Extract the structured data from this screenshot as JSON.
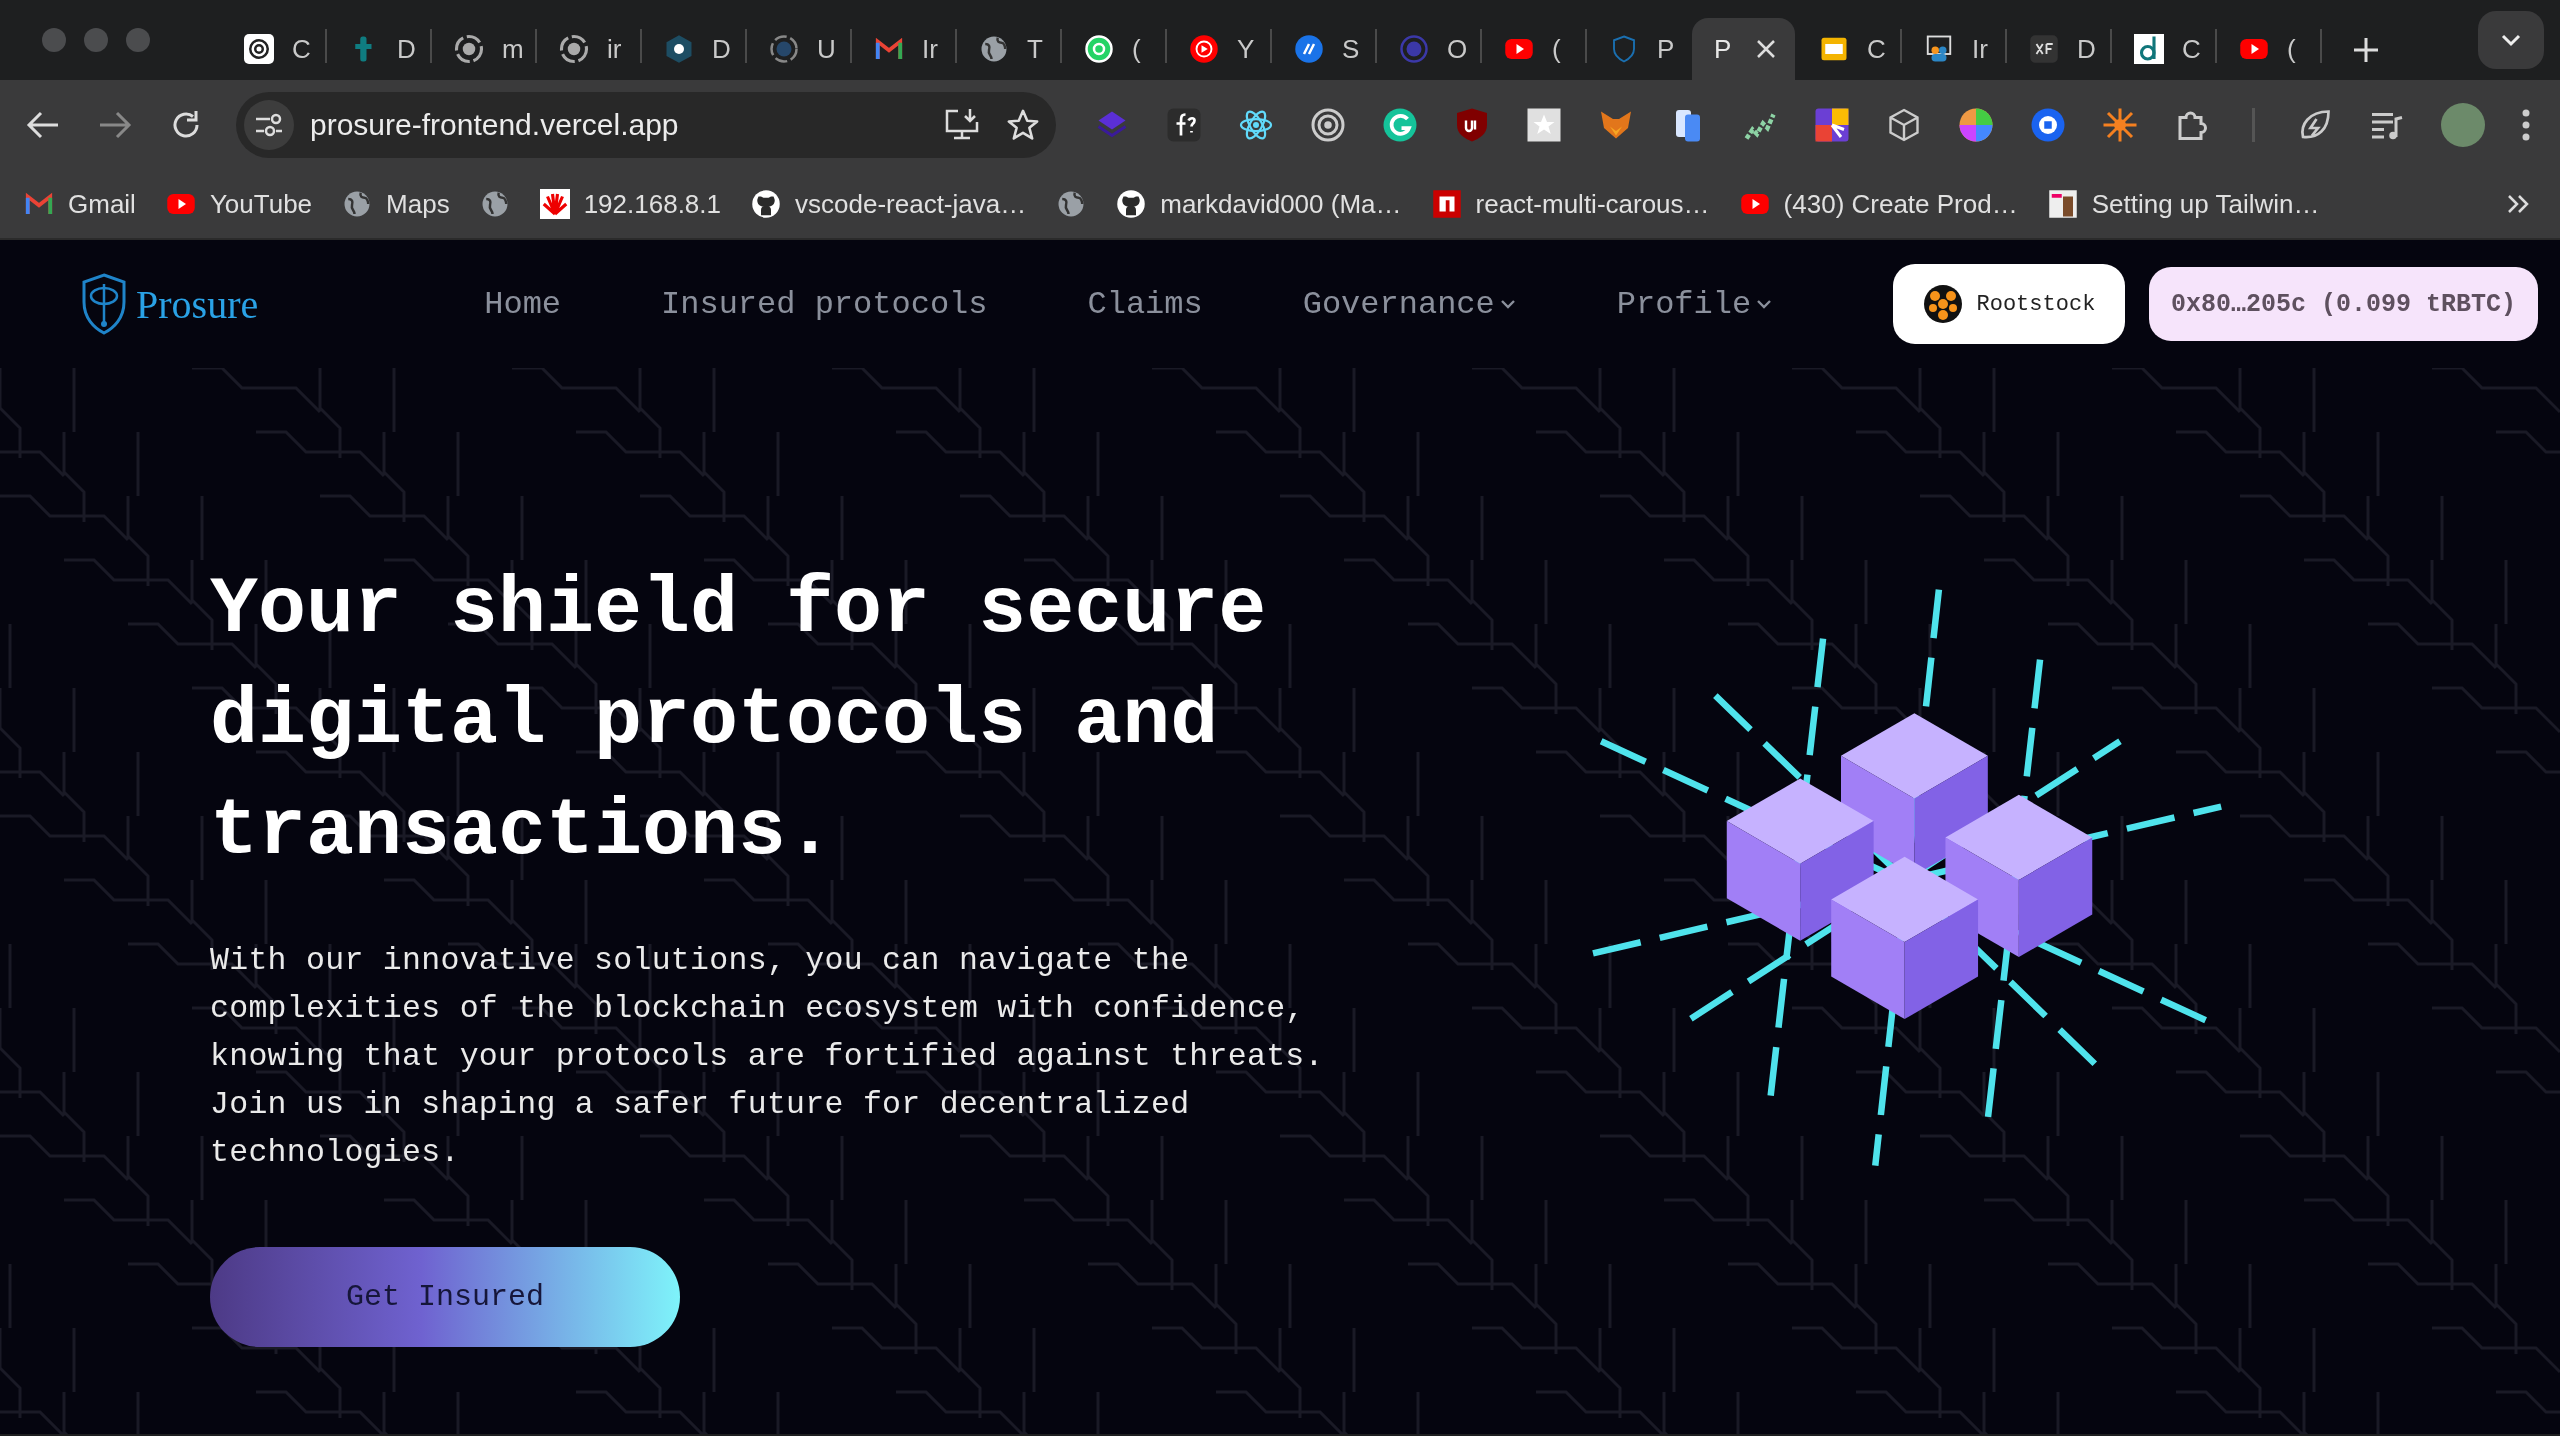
{
  "browser": {
    "tabs": [
      {
        "title": "C",
        "kind": "openai",
        "selected": false
      },
      {
        "title": "D",
        "kind": "tletter",
        "selected": false
      },
      {
        "title": "m",
        "kind": "github",
        "selected": false
      },
      {
        "title": "ir",
        "kind": "github",
        "selected": false
      },
      {
        "title": "D",
        "kind": "dhex",
        "selected": false
      },
      {
        "title": "U",
        "kind": "dring",
        "selected": false
      },
      {
        "title": "Ir",
        "kind": "gmail",
        "selected": false
      },
      {
        "title": "T",
        "kind": "globe",
        "selected": false
      },
      {
        "title": "(",
        "kind": "whatsapp",
        "selected": false
      },
      {
        "title": "Y",
        "kind": "ytmusic",
        "selected": false
      },
      {
        "title": "S",
        "kind": "blue",
        "selected": false
      },
      {
        "title": "O",
        "kind": "ring",
        "selected": false
      },
      {
        "title": "(",
        "kind": "youtube",
        "selected": false
      },
      {
        "title": "P",
        "kind": "shield",
        "selected": false
      },
      {
        "title": "P",
        "kind": "none",
        "selected": true
      },
      {
        "title": "C",
        "kind": "slides",
        "selected": false
      },
      {
        "title": "Ir",
        "kind": "people",
        "selected": false
      },
      {
        "title": "D",
        "kind": "xfs",
        "selected": false
      },
      {
        "title": "C",
        "kind": "dbox",
        "selected": false
      },
      {
        "title": "(",
        "kind": "youtube",
        "selected": false
      }
    ],
    "address_bar": {
      "url": "prosure-frontend.vercel.app"
    },
    "bookmarks": [
      {
        "label": "Gmail",
        "kind": "gmail"
      },
      {
        "label": "YouTube",
        "kind": "youtube"
      },
      {
        "label": "Maps",
        "kind": "globe"
      },
      {
        "kind": "globe"
      },
      {
        "label": "192.168.8.1",
        "kind": "huawei"
      },
      {
        "label": "vscode-react-java…",
        "kind": "github2"
      },
      {
        "kind": "globe"
      },
      {
        "label": "markdavid000 (Ma…",
        "kind": "github2"
      },
      {
        "label": "react-multi-carous…",
        "kind": "npm"
      },
      {
        "label": "(430) Create Prod…",
        "kind": "youtube"
      },
      {
        "label": "Setting up Tailwin…",
        "kind": "thumb"
      }
    ]
  },
  "site": {
    "logo": "Prosure",
    "nav": [
      {
        "label": "Home",
        "dropdown": false
      },
      {
        "label": "Insured protocols",
        "dropdown": false
      },
      {
        "label": "Claims",
        "dropdown": false
      },
      {
        "label": "Governance",
        "dropdown": true
      },
      {
        "label": "Profile",
        "dropdown": true
      }
    ],
    "network_button": "Rootstock",
    "wallet_button": "0x80…205c (0.099 tRBTC)"
  },
  "hero": {
    "heading": "Your shield for secure digital protocols and transactions.",
    "body": "With our innovative solutions, you can navigate the complexities of the blockchain ecosystem with confidence, knowing that your protocols are fortified against threats. Join us in shaping a safer future for decentralized technologies.",
    "cta": "Get Insured"
  }
}
